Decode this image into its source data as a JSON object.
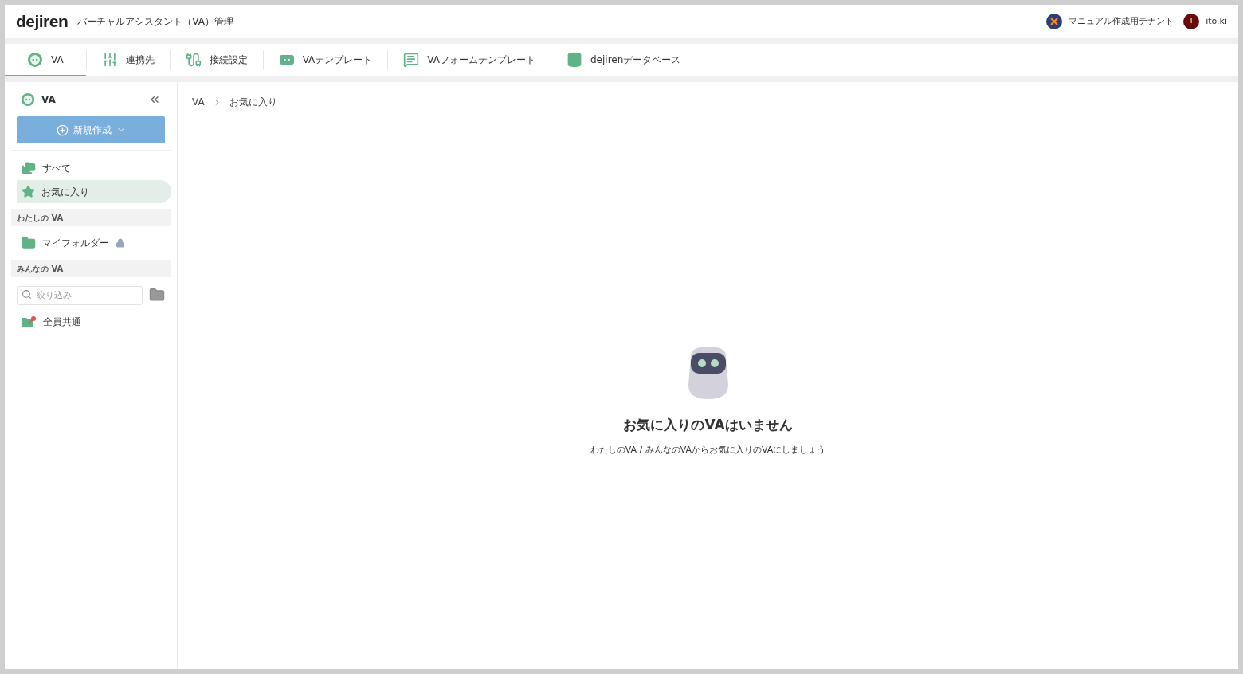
{
  "header": {
    "logo": "dejiren",
    "title": "バーチャルアシスタント（VA）管理",
    "tenant": "マニュアル作成用テナント",
    "user_initial": "I",
    "user": "ito.ki"
  },
  "tabs": [
    {
      "label": "VA",
      "kind": "va",
      "selected": true
    },
    {
      "label": "連携先",
      "kind": "sliders",
      "selected": false
    },
    {
      "label": "接続設定",
      "kind": "plug",
      "selected": false
    },
    {
      "label": "VAテンプレート",
      "kind": "template",
      "selected": false
    },
    {
      "label": "VAフォームテンプレート",
      "kind": "form",
      "selected": false
    },
    {
      "label": "dejirenデータベース",
      "kind": "database",
      "selected": false
    }
  ],
  "sidebar": {
    "title": "VA",
    "new_button": "新規作成",
    "items": [
      {
        "label": "すべて",
        "kind": "folders",
        "selected": false
      },
      {
        "label": "お気に入り",
        "kind": "star",
        "selected": true
      }
    ],
    "sections": [
      {
        "title": "わたしの VA",
        "items": [
          {
            "label": "マイフォルダー",
            "kind": "folder",
            "locked": true
          }
        ]
      },
      {
        "title": "みんなの VA",
        "filter": {
          "placeholder": "絞り込み"
        },
        "items": [
          {
            "label": "全員共通",
            "kind": "pinned",
            "locked": false
          }
        ]
      }
    ]
  },
  "breadcrumb": [
    "VA",
    "お気に入り"
  ],
  "empty_state": {
    "title": "お気に入りのVAはいません",
    "message": "わたしのVA / みんなのVAからお気に入りのVAにしましょう"
  }
}
